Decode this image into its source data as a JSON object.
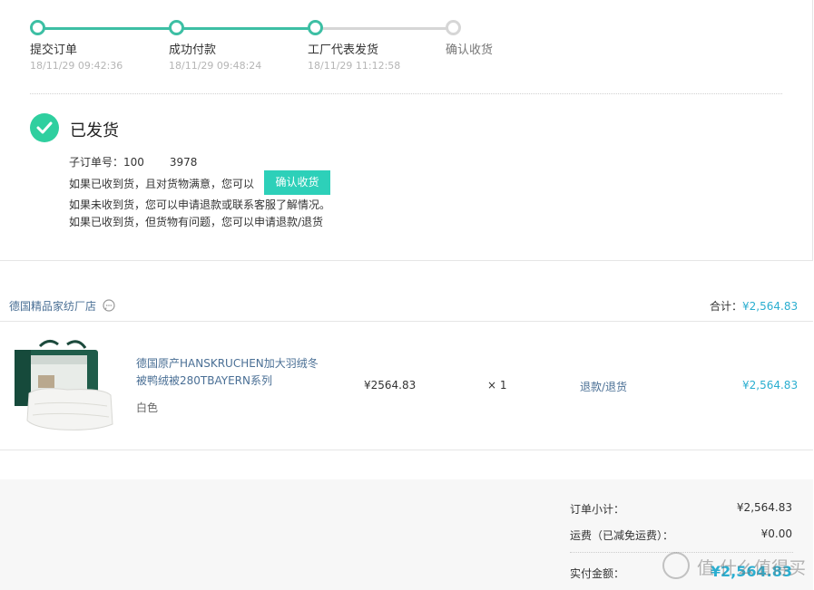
{
  "progress": {
    "steps": [
      {
        "label": "提交订单",
        "time": "18/11/29 09:42:36",
        "done": true
      },
      {
        "label": "成功付款",
        "time": "18/11/29 09:48:24",
        "done": true
      },
      {
        "label": "工厂代表发货",
        "time": "18/11/29 11:12:58",
        "done": true
      },
      {
        "label": "确认收货",
        "time": "",
        "done": false
      }
    ],
    "colors": {
      "done": "#3dbfa4",
      "todo": "#d6d6d6"
    }
  },
  "status": {
    "title": "已发货",
    "suborder_label": "子订单号：100",
    "suborder_tail": "3978",
    "line1": "如果已收到货，且对货物满意，您可以",
    "confirm_button": "确认收货",
    "line2": "如果未收到货，您可以申请退款或联系客服了解情况。",
    "line3": "如果已收到货，但货物有问题，您可以申请退款/退货"
  },
  "store": {
    "name": "德国精品家纺厂店",
    "total_label": "合计：",
    "total_value": "¥2,564.83"
  },
  "item": {
    "title": "德国原产HANSKRUCHEN加大羽绒冬被鸭绒被280TBAYERN系列",
    "variant": "白色",
    "unit_price": "¥2564.83",
    "quantity": "× 1",
    "refund_link": "退款/退货",
    "row_total": "¥2,564.83"
  },
  "summary": {
    "subtotal_label": "订单小计：",
    "subtotal_value": "¥2,564.83",
    "shipping_label": "运费（已减免运费）：",
    "shipping_value": "¥0.00",
    "paid_label": "实付金额：",
    "paid_value": "¥2,564.83"
  },
  "watermark": {
    "text": "值 什么值得买"
  },
  "accent_color": "#2aaed0",
  "button_color": "#2dd0b9"
}
